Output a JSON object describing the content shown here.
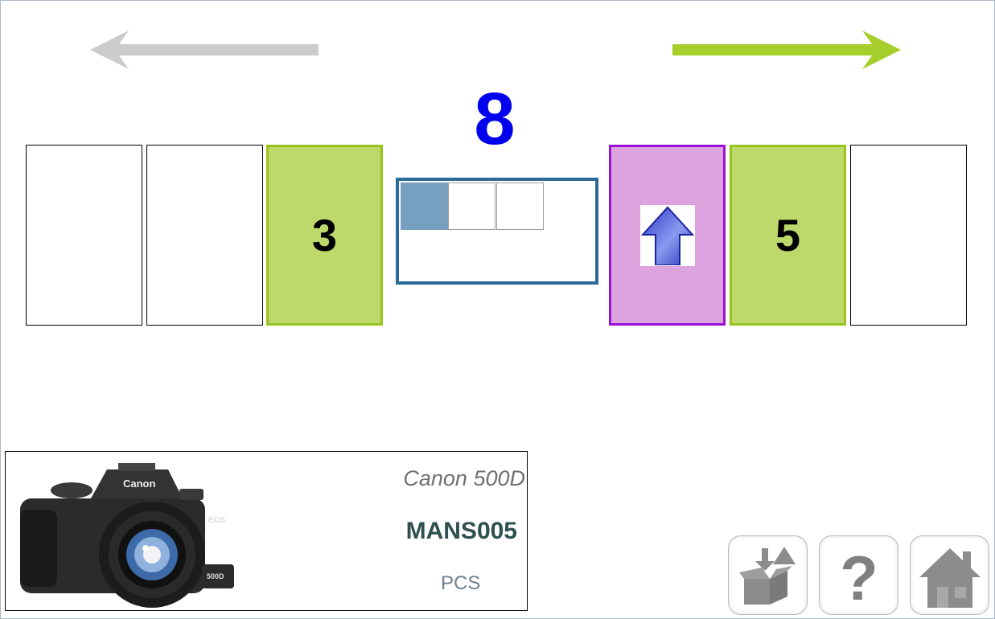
{
  "counter": {
    "value": "8"
  },
  "slots": [
    {
      "label": ""
    },
    {
      "label": ""
    },
    {
      "label": "3"
    },
    {
      "label": "5"
    },
    {
      "label": ""
    }
  ],
  "product": {
    "model": "Canon 500D",
    "reference": "MANS005",
    "unit": "PCS",
    "image_icon": "camera-photo"
  },
  "colors": {
    "counter": "#0000ee",
    "slot_green": "#bdd86b",
    "slot_active": "#dda3de",
    "grid_border": "#2b6a96",
    "next_arrow": "#a6cf2b",
    "prev_arrow": "#cccccc"
  },
  "icons": {
    "prev": "arrow-left-icon",
    "next": "arrow-right-icon",
    "active_slot": "arrow-up-icon",
    "toolbar": [
      "box-unload-icon",
      "help-icon",
      "home-icon"
    ]
  }
}
